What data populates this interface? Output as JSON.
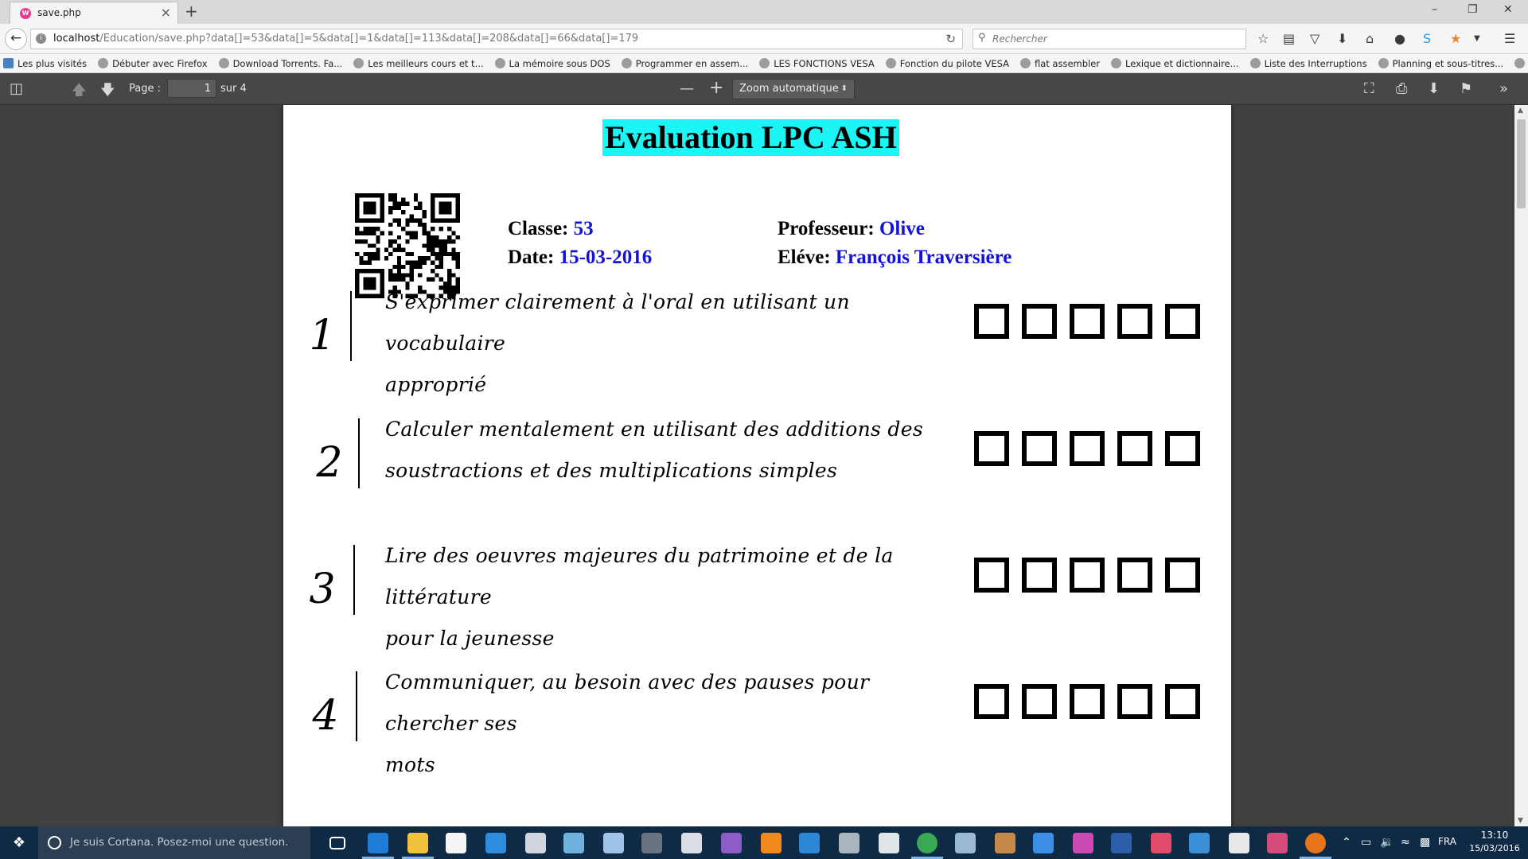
{
  "browser": {
    "tab": {
      "title": "save.php",
      "favicon_text": "W"
    },
    "url": {
      "host": "localhost",
      "path": "/Education/save.php?data[]=53&data[]=5&data[]=1&data[]=113&data[]=208&data[]=66&data[]=179"
    },
    "search": {
      "placeholder": "Rechercher"
    },
    "bookmarks": [
      "Les plus visités",
      "Débuter avec Firefox",
      "Download Torrents. Fa...",
      "Les meilleurs cours et t...",
      "La mémoire sous DOS",
      "Programmer en assem...",
      "LES FONCTIONS VESA",
      "Fonction du pilote VESA",
      "flat assembler",
      "Lexique et dictionnaire...",
      "Liste des Interruptions",
      "Planning et sous-titres...",
      "Free Mobile - Bienven..."
    ]
  },
  "pdf_toolbar": {
    "page_label": "Page :",
    "page_value": "1",
    "page_total": "sur 4",
    "zoom": "Zoom automatique"
  },
  "document": {
    "title": "Evaluation LPC ASH",
    "classe_label": "Classe: ",
    "classe": "53",
    "date_label": "Date: ",
    "date": "15-03-2016",
    "professeur_label": "Professeur: ",
    "professeur": "Olive",
    "eleve_label": "Eléve: ",
    "eleve": "François Traversière",
    "competences": [
      {
        "num": "1",
        "line1": "S'exprimer clairement à l'oral en utilisant un vocabulaire",
        "line2": "approprié"
      },
      {
        "num": "2",
        "line1": "Calculer mentalement en utilisant des additions des",
        "line2": "soustractions et des multiplications simples"
      },
      {
        "num": "3",
        "line1": "Lire des oeuvres majeures du patrimoine et de la littérature",
        "line2": "pour la jeunesse"
      },
      {
        "num": "4",
        "line1": "Communiquer, au besoin avec des pauses pour chercher ses",
        "line2": "mots"
      }
    ]
  },
  "taskbar": {
    "cortana": "Je suis Cortana. Posez-moi une question.",
    "lang": "FRA",
    "time": "13:10",
    "date": "15/03/2016"
  },
  "colors": {
    "title_highlight": "#1cf5f5",
    "value_blue": "#1212d8",
    "taskbar": "#0f2a44"
  }
}
